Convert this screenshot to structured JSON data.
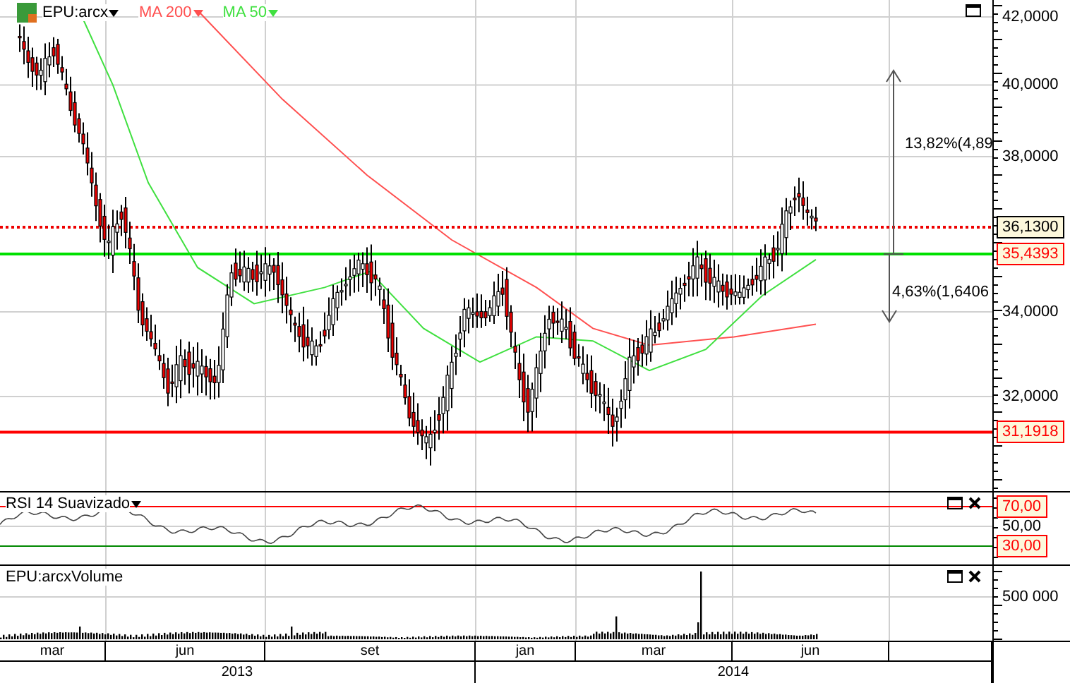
{
  "legend": {
    "symbol": "EPU:arcx",
    "indicators": [
      {
        "label": "MA 200",
        "color": "#ff5050"
      },
      {
        "label": "MA 50",
        "color": "#40e040"
      }
    ]
  },
  "price_axis": {
    "ticks": [
      "42,0000",
      "40,0000",
      "38,0000",
      "34,0000",
      "32,0000"
    ]
  },
  "levels": [
    {
      "kind": "last",
      "label": "36,1300"
    },
    {
      "kind": "support",
      "label": "35,4393"
    },
    {
      "kind": "low",
      "label": "31,1918"
    }
  ],
  "measure": {
    "up": "13,82%(4,89",
    "down": "4,63%(1,6406"
  },
  "rsi": {
    "title": "RSI 14 Suavizado",
    "ticks": [
      {
        "label": "70,00",
        "kind": "upper"
      },
      {
        "label": "50,00",
        "kind": "mid"
      },
      {
        "label": "30,00",
        "kind": "lower"
      }
    ]
  },
  "volume": {
    "title": "EPU:arcxVolume",
    "ticks": [
      "500 000"
    ]
  },
  "months": [
    "mar",
    "jun",
    "set",
    "jan",
    "mar",
    "jun"
  ],
  "years": [
    "2013",
    "2014"
  ]
}
